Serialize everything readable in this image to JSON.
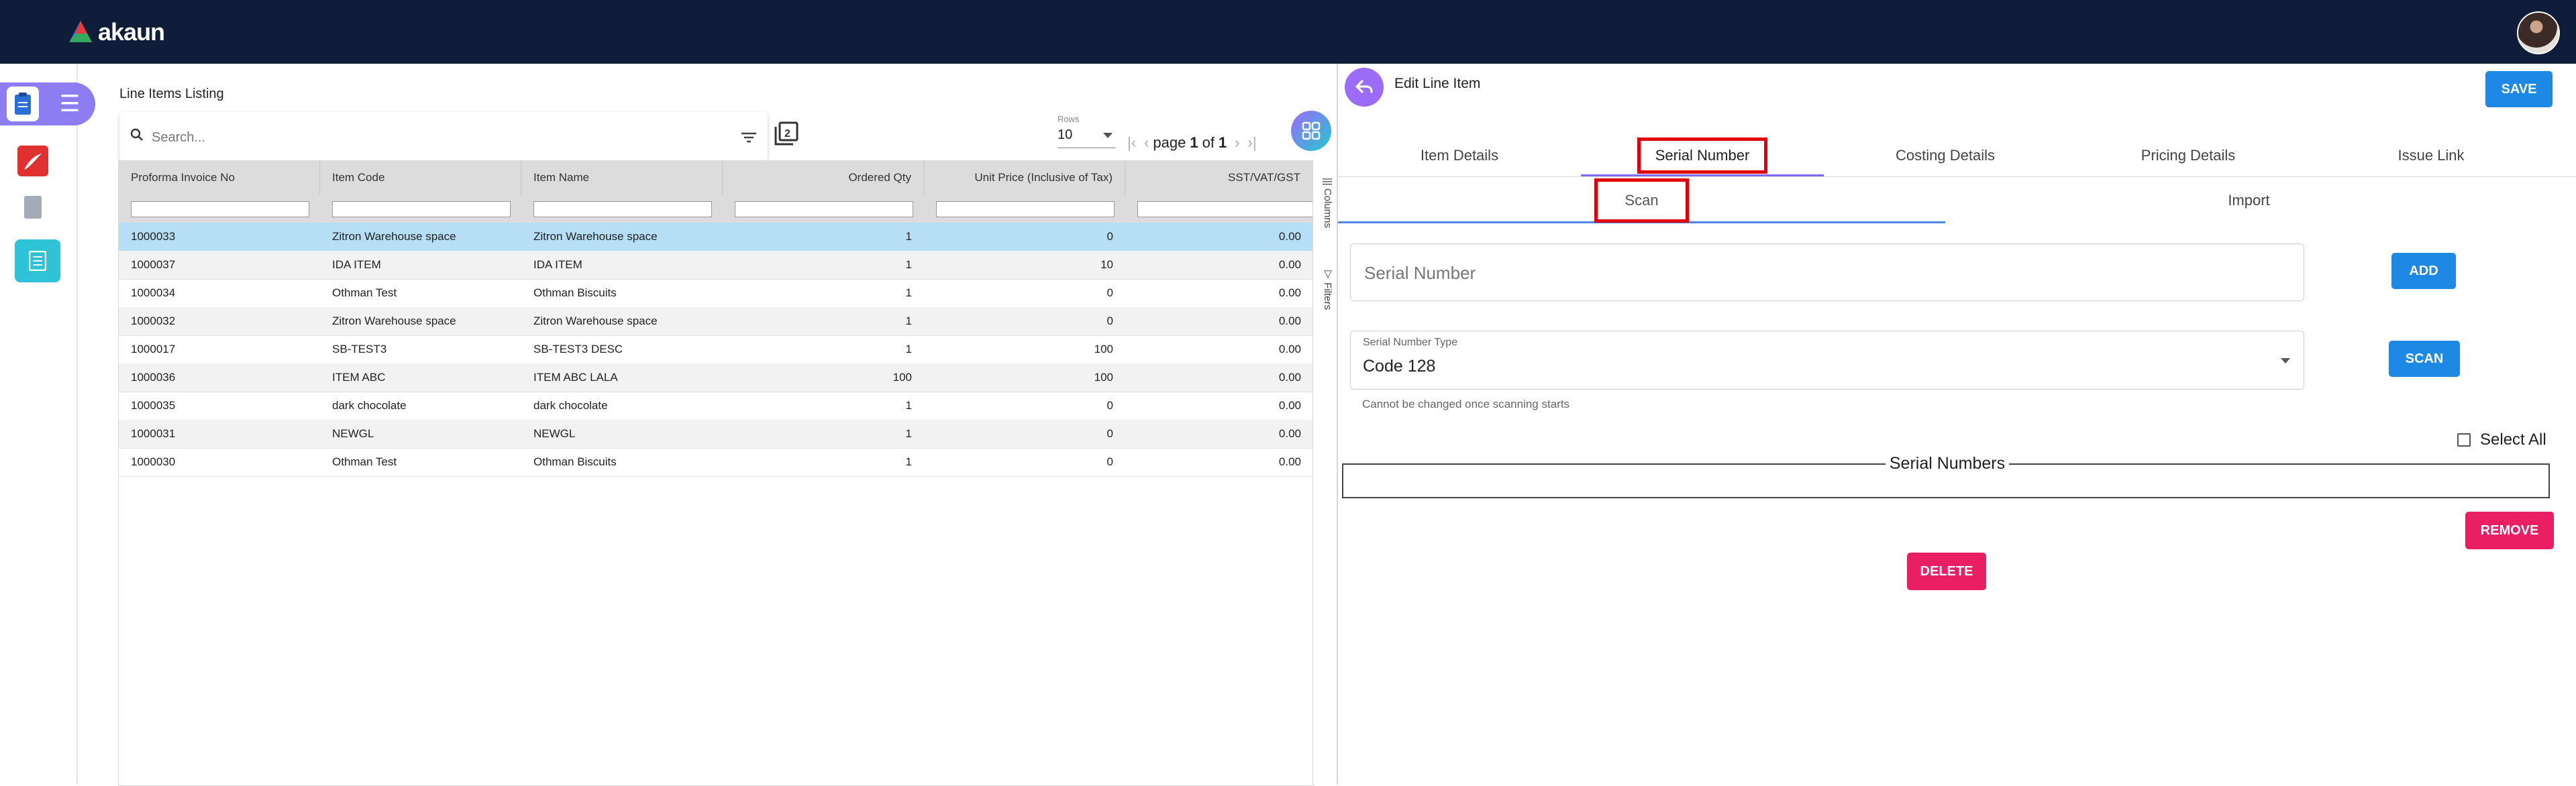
{
  "header": {
    "brand": "akaun"
  },
  "listing": {
    "title": "Line Items Listing",
    "search_placeholder": "Search...",
    "rows_label": "Rows",
    "rows_value": "10",
    "page_word": "page",
    "page_current": "1",
    "of_word": "of",
    "page_total": "1",
    "columns": [
      "Proforma Invoice No",
      "Item Code",
      "Item Name",
      "Ordered Qty",
      "Unit Price (Inclusive of Tax)",
      "SST/VAT/GST"
    ],
    "rows": [
      [
        "1000033",
        "Zitron Warehouse space",
        "Zitron Warehouse space",
        "1",
        "0",
        "0.00"
      ],
      [
        "1000037",
        "IDA ITEM",
        "IDA ITEM",
        "1",
        "10",
        "0.00"
      ],
      [
        "1000034",
        "Othman Test",
        "Othman Biscuits",
        "1",
        "0",
        "0.00"
      ],
      [
        "1000032",
        "Zitron Warehouse space",
        "Zitron Warehouse space",
        "1",
        "0",
        "0.00"
      ],
      [
        "1000017",
        "SB-TEST3",
        "SB-TEST3 DESC",
        "1",
        "100",
        "0.00"
      ],
      [
        "1000036",
        "ITEM ABC",
        "ITEM ABC LALA",
        "100",
        "100",
        "0.00"
      ],
      [
        "1000035",
        "dark chocolate",
        "dark chocolate",
        "1",
        "0",
        "0.00"
      ],
      [
        "1000031",
        "NEWGL",
        "NEWGL",
        "1",
        "0",
        "0.00"
      ],
      [
        "1000030",
        "Othman Test",
        "Othman Biscuits",
        "1",
        "0",
        "0.00"
      ]
    ],
    "side_tabs": {
      "columns": "Columns",
      "filters": "Filters"
    }
  },
  "editor": {
    "title": "Edit Line Item",
    "save_label": "SAVE",
    "tabs": [
      {
        "label": "Item Details"
      },
      {
        "label": "Serial Number"
      },
      {
        "label": "Costing Details"
      },
      {
        "label": "Pricing Details"
      },
      {
        "label": "Issue Link"
      }
    ],
    "subtabs": [
      {
        "label": "Scan"
      },
      {
        "label": "Import"
      }
    ],
    "serial_placeholder": "Serial Number",
    "add_label": "ADD",
    "type_label": "Serial Number Type",
    "type_value": "Code 128",
    "type_helper": "Cannot be changed once scanning starts",
    "scan_label": "SCAN",
    "select_all_label": "Select All",
    "serial_numbers_legend": "Serial Numbers",
    "remove_label": "REMOVE",
    "delete_label": "DELETE"
  },
  "colors": {
    "topbar": "#0f1d3a",
    "primary": "#1e88e5",
    "danger": "#e91e63",
    "accent": "#8e7cf3",
    "highlight_box": "#e0000b",
    "selected_row": "#b6dff5"
  },
  "icons": [
    "menu-toggle-icon",
    "clipboard-icon",
    "pdf-icon",
    "document-icon",
    "list-icon",
    "search-icon",
    "filter-icon",
    "copy-icon",
    "grid-icon",
    "back-arrow-icon",
    "dropdown-caret-icon"
  ]
}
